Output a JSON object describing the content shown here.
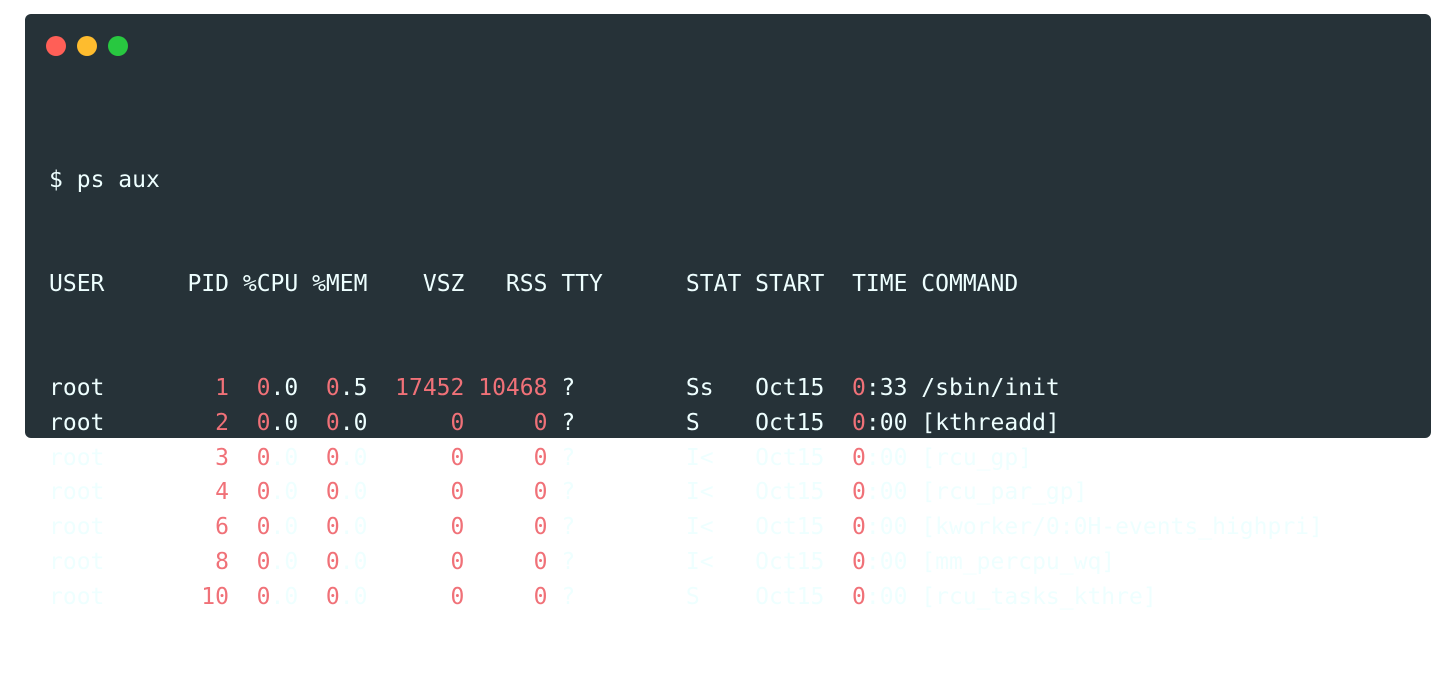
{
  "window": {
    "controls": [
      {
        "name": "close",
        "color": "#ff5f57"
      },
      {
        "name": "minimize",
        "color": "#febc2e"
      },
      {
        "name": "zoom",
        "color": "#28c840"
      }
    ],
    "background": "#263238",
    "text_color": "#eeffff",
    "number_color": "#f07178"
  },
  "terminal": {
    "prompt": "$",
    "command": "ps aux",
    "headers": {
      "user": "USER",
      "pid": "PID",
      "cpu": "%CPU",
      "mem": "%MEM",
      "vsz": "VSZ",
      "rss": "RSS",
      "tty": "TTY",
      "stat": "STAT",
      "start": "START",
      "time": "TIME",
      "command": "COMMAND"
    },
    "rows": [
      {
        "user": "root",
        "pid": "1",
        "cpu": "0.0",
        "mem": "0.5",
        "vsz": "17452",
        "rss": "10468",
        "tty": "?",
        "stat": "Ss",
        "start": "Oct15",
        "time": "0:33",
        "command": "/sbin/init"
      },
      {
        "user": "root",
        "pid": "2",
        "cpu": "0.0",
        "mem": "0.0",
        "vsz": "0",
        "rss": "0",
        "tty": "?",
        "stat": "S",
        "start": "Oct15",
        "time": "0:00",
        "command": "[kthreadd]"
      },
      {
        "user": "root",
        "pid": "3",
        "cpu": "0.0",
        "mem": "0.0",
        "vsz": "0",
        "rss": "0",
        "tty": "?",
        "stat": "I<",
        "start": "Oct15",
        "time": "0:00",
        "command": "[rcu_gp]"
      },
      {
        "user": "root",
        "pid": "4",
        "cpu": "0.0",
        "mem": "0.0",
        "vsz": "0",
        "rss": "0",
        "tty": "?",
        "stat": "I<",
        "start": "Oct15",
        "time": "0:00",
        "command": "[rcu_par_gp]"
      },
      {
        "user": "root",
        "pid": "6",
        "cpu": "0.0",
        "mem": "0.0",
        "vsz": "0",
        "rss": "0",
        "tty": "?",
        "stat": "I<",
        "start": "Oct15",
        "time": "0:00",
        "command": "[kworker/0:0H-events_highpri]"
      },
      {
        "user": "root",
        "pid": "8",
        "cpu": "0.0",
        "mem": "0.0",
        "vsz": "0",
        "rss": "0",
        "tty": "?",
        "stat": "I<",
        "start": "Oct15",
        "time": "0:00",
        "command": "[mm_percpu_wq]"
      },
      {
        "user": "root",
        "pid": "10",
        "cpu": "0.0",
        "mem": "0.0",
        "vsz": "0",
        "rss": "0",
        "tty": "?",
        "stat": "S",
        "start": "Oct15",
        "time": "0:00",
        "command": "[rcu_tasks_kthre]"
      }
    ]
  }
}
